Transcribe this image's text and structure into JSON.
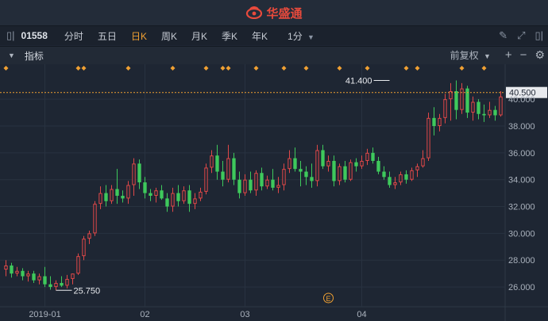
{
  "app": {
    "title": "华盛通"
  },
  "toolbar": {
    "stock_code": "01558",
    "periods": [
      "分时",
      "五日",
      "日K",
      "周K",
      "月K",
      "季K",
      "年K"
    ],
    "active_period": "日K",
    "minute_select": "1分"
  },
  "indicator_bar": {
    "label": "指标",
    "adjust_mode": "前复权",
    "plus": "+",
    "minus": "−"
  },
  "colors": {
    "up": "#e04848",
    "down": "#3ec95c",
    "accent": "#f0a032",
    "background": "#1e2633"
  },
  "chart_data": {
    "type": "candlestick",
    "y_ticks": [
      "26.000",
      "28.000",
      "30.000",
      "32.000",
      "34.000",
      "36.000",
      "38.000",
      "40.000"
    ],
    "ylim": [
      25.0,
      41.9
    ],
    "x_ticks": [
      {
        "label": "2019-01",
        "index": 7
      },
      {
        "label": "02",
        "index": 25
      },
      {
        "label": "03",
        "index": 43
      },
      {
        "label": "04",
        "index": 64
      }
    ],
    "price_line": {
      "value": 40.5,
      "label": "40.500"
    },
    "max_marker": {
      "value": 41.4,
      "label": "41.400",
      "index": 69
    },
    "min_marker": {
      "value": 25.75,
      "label": "25.750",
      "index": 9
    },
    "event_marker": {
      "label": "E",
      "index": 58
    },
    "event_dots": [
      0,
      13,
      14,
      22,
      30,
      36,
      39,
      40,
      45,
      50,
      54,
      60,
      65,
      72,
      74,
      82,
      86
    ],
    "candles": [
      [
        27.3,
        28.0,
        26.8,
        27.6
      ],
      [
        27.6,
        27.8,
        26.7,
        27.0
      ],
      [
        27.0,
        27.5,
        26.8,
        27.2
      ],
      [
        27.2,
        27.4,
        26.5,
        26.8
      ],
      [
        26.8,
        27.2,
        26.4,
        27.0
      ],
      [
        27.0,
        27.2,
        26.3,
        26.5
      ],
      [
        26.5,
        27.0,
        26.2,
        26.8
      ],
      [
        26.8,
        27.5,
        26.0,
        26.2
      ],
      [
        26.2,
        26.8,
        25.8,
        26.0
      ],
      [
        26.0,
        26.5,
        25.75,
        26.3
      ],
      [
        26.3,
        26.8,
        26.0,
        26.1
      ],
      [
        26.1,
        26.9,
        25.9,
        26.6
      ],
      [
        26.6,
        27.0,
        26.2,
        27.0
      ],
      [
        27.0,
        28.5,
        26.9,
        28.3
      ],
      [
        28.3,
        29.8,
        28.0,
        29.6
      ],
      [
        29.6,
        30.2,
        29.2,
        30.0
      ],
      [
        30.0,
        32.4,
        29.8,
        32.2
      ],
      [
        32.2,
        33.5,
        31.8,
        33.0
      ],
      [
        33.0,
        33.6,
        32.0,
        32.4
      ],
      [
        32.4,
        33.6,
        32.2,
        33.3
      ],
      [
        33.3,
        34.8,
        32.2,
        32.8
      ],
      [
        32.8,
        33.2,
        32.3,
        32.6
      ],
      [
        32.6,
        33.9,
        32.2,
        33.6
      ],
      [
        33.6,
        35.6,
        32.8,
        35.2
      ],
      [
        35.2,
        35.5,
        33.3,
        33.8
      ],
      [
        33.8,
        34.2,
        32.6,
        33.0
      ],
      [
        33.0,
        33.3,
        32.4,
        32.8
      ],
      [
        32.8,
        33.4,
        32.3,
        33.2
      ],
      [
        33.2,
        33.6,
        32.5,
        32.6
      ],
      [
        32.6,
        33.0,
        31.6,
        32.0
      ],
      [
        32.0,
        33.4,
        31.6,
        33.0
      ],
      [
        33.0,
        33.6,
        32.0,
        32.4
      ],
      [
        32.4,
        33.5,
        32.2,
        33.2
      ],
      [
        33.2,
        33.6,
        31.6,
        32.2
      ],
      [
        32.2,
        33.0,
        31.8,
        32.6
      ],
      [
        32.6,
        33.4,
        32.4,
        33.1
      ],
      [
        33.1,
        35.2,
        32.9,
        34.9
      ],
      [
        34.9,
        36.2,
        34.5,
        35.8
      ],
      [
        35.8,
        36.6,
        34.0,
        34.6
      ],
      [
        34.6,
        35.4,
        33.5,
        34.0
      ],
      [
        34.0,
        36.6,
        33.8,
        35.6
      ],
      [
        35.6,
        36.0,
        33.6,
        34.0
      ],
      [
        34.0,
        34.6,
        32.6,
        33.0
      ],
      [
        33.0,
        34.4,
        32.8,
        34.0
      ],
      [
        34.0,
        34.6,
        33.0,
        33.2
      ],
      [
        33.2,
        34.7,
        32.8,
        34.5
      ],
      [
        34.5,
        34.9,
        33.2,
        33.5
      ],
      [
        33.5,
        34.3,
        33.3,
        34.0
      ],
      [
        34.0,
        34.8,
        33.2,
        33.4
      ],
      [
        33.4,
        34.2,
        33.0,
        33.6
      ],
      [
        33.6,
        35.2,
        33.2,
        34.8
      ],
      [
        34.8,
        36.2,
        34.5,
        35.6
      ],
      [
        35.6,
        36.4,
        34.6,
        34.8
      ],
      [
        34.8,
        35.4,
        33.5,
        34.6
      ],
      [
        34.6,
        35.0,
        33.6,
        34.2
      ],
      [
        34.2,
        35.2,
        33.4,
        33.9
      ],
      [
        33.9,
        36.6,
        33.5,
        36.2
      ],
      [
        36.2,
        36.6,
        34.8,
        35.0
      ],
      [
        35.0,
        35.8,
        34.6,
        35.4
      ],
      [
        35.4,
        35.8,
        33.5,
        33.9
      ],
      [
        33.9,
        35.2,
        33.6,
        35.0
      ],
      [
        35.0,
        35.4,
        33.8,
        34.0
      ],
      [
        34.0,
        35.5,
        33.9,
        35.3
      ],
      [
        35.3,
        35.6,
        34.6,
        35.0
      ],
      [
        35.0,
        35.8,
        34.8,
        35.4
      ],
      [
        35.4,
        36.3,
        35.1,
        36.0
      ],
      [
        36.0,
        36.4,
        35.2,
        35.4
      ],
      [
        35.4,
        35.7,
        34.4,
        34.6
      ],
      [
        34.6,
        35.0,
        34.0,
        34.2
      ],
      [
        34.2,
        34.6,
        33.4,
        33.6
      ],
      [
        33.6,
        34.2,
        33.3,
        33.8
      ],
      [
        33.8,
        34.6,
        33.6,
        34.4
      ],
      [
        34.4,
        34.7,
        33.7,
        34.0
      ],
      [
        34.0,
        34.9,
        33.9,
        34.7
      ],
      [
        34.7,
        35.2,
        34.2,
        35.0
      ],
      [
        35.0,
        36.2,
        34.9,
        35.6
      ],
      [
        35.6,
        39.0,
        35.4,
        38.6
      ],
      [
        38.6,
        39.4,
        37.3,
        38.0
      ],
      [
        38.0,
        38.9,
        37.6,
        38.6
      ],
      [
        38.6,
        40.4,
        38.2,
        40.0
      ],
      [
        40.0,
        41.2,
        38.4,
        40.6
      ],
      [
        40.6,
        41.4,
        38.5,
        39.2
      ],
      [
        39.2,
        41.2,
        38.9,
        40.8
      ],
      [
        40.8,
        41.0,
        38.6,
        39.0
      ],
      [
        39.0,
        40.2,
        38.4,
        39.8
      ],
      [
        39.8,
        40.0,
        38.5,
        38.9
      ],
      [
        38.9,
        39.6,
        38.3,
        38.8
      ],
      [
        38.8,
        39.8,
        38.6,
        39.2
      ],
      [
        39.2,
        39.5,
        38.4,
        38.8
      ],
      [
        38.8,
        40.6,
        38.7,
        40.2
      ]
    ]
  }
}
